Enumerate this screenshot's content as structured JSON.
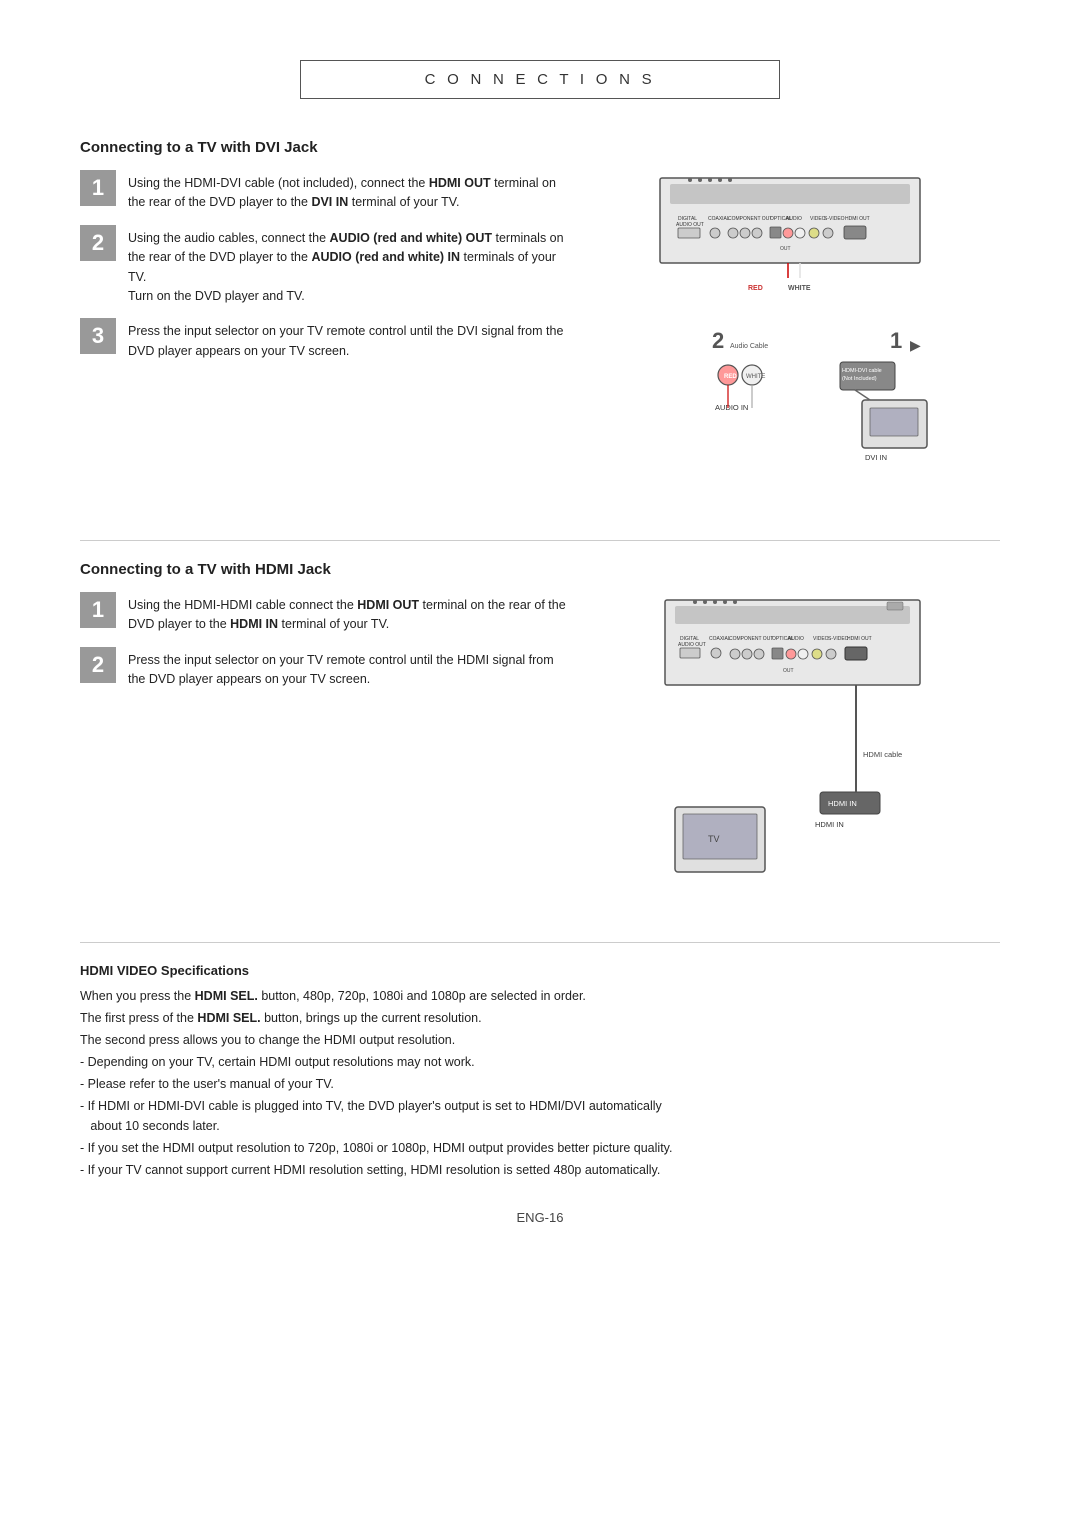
{
  "page": {
    "title": "C O N N E C T I O N S",
    "page_number": "ENG-16"
  },
  "dvi_section": {
    "title": "Connecting to a TV with DVI Jack",
    "steps": [
      {
        "number": "1",
        "text_parts": [
          {
            "text": "Using the HDMI-DVI cable (not included), connect the "
          },
          {
            "bold": "HDMI OUT"
          },
          {
            "text": " terminal on the rear of the DVD player to the "
          },
          {
            "bold": "DVI IN"
          },
          {
            "text": " terminal of your TV."
          }
        ]
      },
      {
        "number": "2",
        "text_parts": [
          {
            "text": "Using the audio cables, connect the "
          },
          {
            "bold": "AUDIO (red and white) OUT"
          },
          {
            "text": " terminals on the rear of the DVD player to the "
          },
          {
            "bold": "AUDIO (red and white) IN"
          },
          {
            "text": " terminals of your TV.\nTurn on the DVD player and TV."
          }
        ]
      },
      {
        "number": "3",
        "text_parts": [
          {
            "text": "Press the input selector on your TV remote control until the DVI signal from the DVD player appears on your TV screen."
          }
        ]
      }
    ]
  },
  "hdmi_section": {
    "title": "Connecting to a TV with HDMI Jack",
    "steps": [
      {
        "number": "1",
        "text_parts": [
          {
            "text": "Using the HDMI-HDMI cable connect the "
          },
          {
            "bold": "HDMI OUT"
          },
          {
            "text": " terminal on the rear of the DVD player to the "
          },
          {
            "bold": "HDMI IN"
          },
          {
            "text": " terminal of your TV."
          }
        ]
      },
      {
        "number": "2",
        "text_parts": [
          {
            "text": "Press the input selector on your TV remote control until the HDMI signal from the DVD player appears on your TV screen."
          }
        ]
      }
    ]
  },
  "hdmi_specs": {
    "title": "HDMI VIDEO Specifications",
    "paragraphs": [
      "When you press the HDMI SEL. button, 480p, 720p, 1080i and 1080p  are selected in order.",
      "The first press of the HDMI SEL. button, brings up the current resolution.",
      "The second press allows you to change the HDMI output resolution."
    ],
    "bullets": [
      "- Depending on your TV, certain HDMI output resolutions may not work.",
      "- Please refer to the user's manual of your TV.",
      "- If HDMI or HDMI-DVI cable is plugged into TV, the DVD player's output is set to HDMI/DVI automatically\n   about 10 seconds later.",
      "- If you set the HDMI output resolution to 720p, 1080i or 1080p, HDMI output provides better picture quality.",
      "-  If your TV cannot support current HDMI resolution setting, HDMI resolution is setted 480p automatically."
    ]
  }
}
